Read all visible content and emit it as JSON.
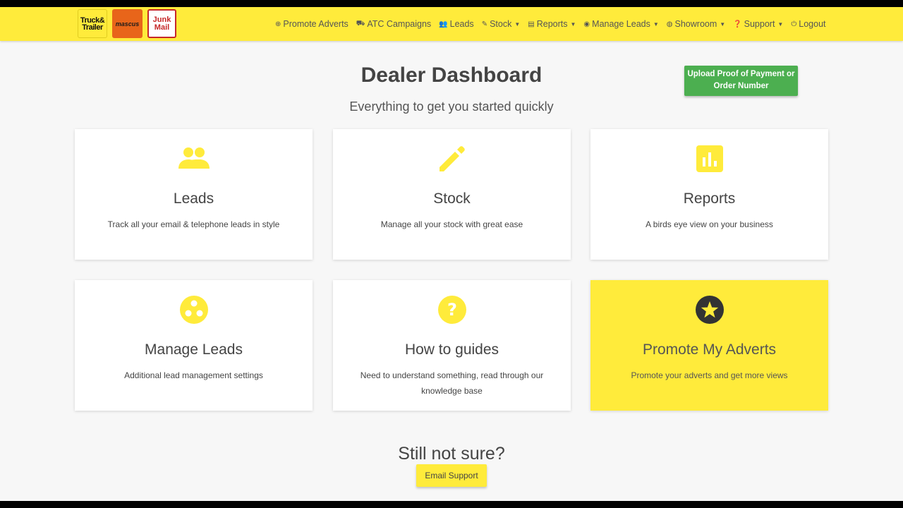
{
  "colors": {
    "brand_yellow": "#ffeb3b",
    "upload_green": "#4caf50",
    "icon_yellow": "#ffeb3b",
    "icon_dark": "#333333"
  },
  "logos": {
    "truck_trailer": [
      "Truck&",
      "Trailer"
    ],
    "mascus": "mascus",
    "junk_mail": [
      "Junk",
      "Mail"
    ]
  },
  "nav": [
    {
      "label": "Promote Adverts",
      "icon": "plus-circle-icon",
      "dropdown": false
    },
    {
      "label": "ATC Campaigns",
      "icon": "car-icon",
      "dropdown": false
    },
    {
      "label": "Leads",
      "icon": "users-icon",
      "dropdown": false
    },
    {
      "label": "Stock",
      "icon": "pencil-icon",
      "dropdown": true
    },
    {
      "label": "Reports",
      "icon": "chart-icon",
      "dropdown": true
    },
    {
      "label": "Manage Leads",
      "icon": "circles-icon",
      "dropdown": true
    },
    {
      "label": "Showroom",
      "icon": "user-circle-icon",
      "dropdown": true
    },
    {
      "label": "Support",
      "icon": "question-icon",
      "dropdown": true
    },
    {
      "label": "Logout",
      "icon": "power-icon",
      "dropdown": false
    }
  ],
  "header": {
    "title": "Dealer Dashboard",
    "subtitle": "Everything to get you started quickly",
    "upload_button": "Upload Proof of Payment or Order Number"
  },
  "cards": [
    {
      "name": "Leads",
      "desc": "Track all your email & telephone leads in style",
      "icon": "people-icon"
    },
    {
      "name": "Stock",
      "desc": "Manage all your stock with great ease",
      "icon": "pencil-icon"
    },
    {
      "name": "Reports",
      "desc": "A birds eye view on your business",
      "icon": "bar-chart-icon"
    },
    {
      "name": "Manage Leads",
      "desc": "Additional lead management settings",
      "icon": "bubble-chart-icon"
    },
    {
      "name": "How to guides",
      "desc": "Need to understand something, read through our knowledge base",
      "icon": "help-icon"
    },
    {
      "name": "Promote My Adverts",
      "desc": "Promote your adverts and get more views",
      "icon": "star-circle-icon"
    }
  ],
  "footer": {
    "heading": "Still not sure?",
    "email_button": "Email Support"
  }
}
